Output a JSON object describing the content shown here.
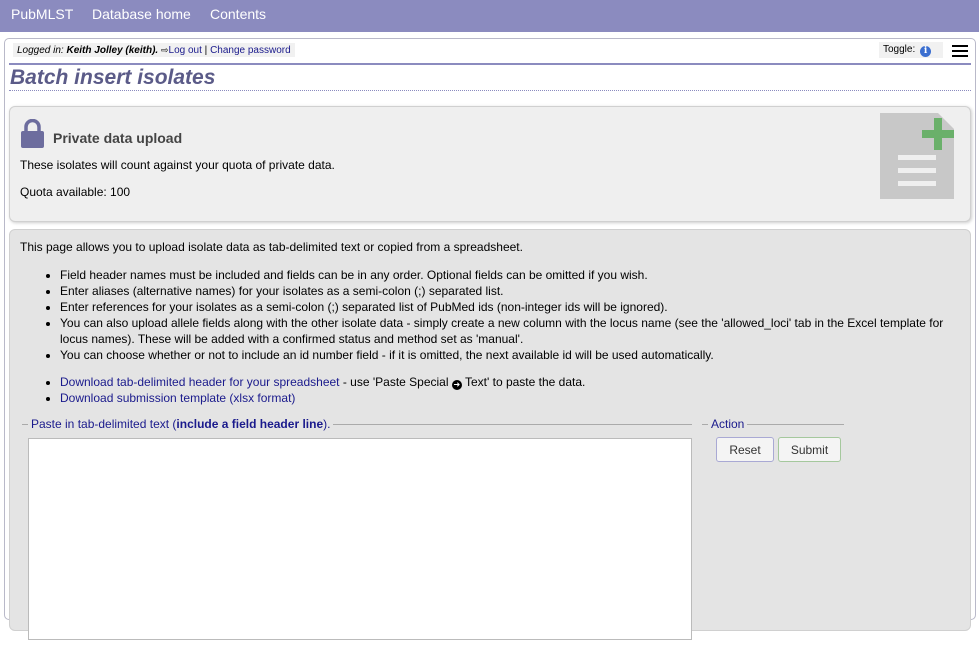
{
  "nav": {
    "items": [
      "PubMLST",
      "Database home",
      "Contents"
    ]
  },
  "userbar": {
    "logged_in_label": "Logged in:",
    "user": "Keith Jolley (keith).",
    "logout": "Log out",
    "separator": "|",
    "change_password": "Change password"
  },
  "toggle": {
    "label": "Toggle:"
  },
  "page_title": "Batch insert isolates",
  "private_box": {
    "heading": "Private data upload",
    "text": "These isolates will count against your quota of private data.",
    "quota": "Quota available: 100"
  },
  "info": {
    "intro": "This page allows you to upload isolate data as tab-delimited text or copied from a spreadsheet.",
    "bullets": [
      "Field header names must be included and fields can be in any order. Optional fields can be omitted if you wish.",
      "Enter aliases (alternative names) for your isolates as a semi-colon (;) separated list.",
      "Enter references for your isolates as a semi-colon (;) separated list of PubMed ids (non-integer ids will be ignored).",
      "You can also upload allele fields along with the other isolate data - simply create a new column with the locus name (see the 'allowed_loci' tab in the Excel template for locus names). These will be added with a confirmed status and method set as 'manual'.",
      "You can choose whether or not to include an id number field - if it is omitted, the next available id will be used automatically."
    ],
    "download_header_link": "Download tab-delimited header for your spreadsheet",
    "download_header_suffix_a": " - use 'Paste Special ",
    "download_header_suffix_b": " Text' to paste the data.",
    "download_template_link": "Download submission template (xlsx format)"
  },
  "paste": {
    "legend_a": "Paste in tab-delimited text (",
    "legend_bold": "include a field header line",
    "legend_b": ").",
    "value": ""
  },
  "action": {
    "legend": "Action",
    "reset": "Reset",
    "submit": "Submit"
  },
  "colors": {
    "brand": "#8b8bbf",
    "title": "#5b5b88",
    "link": "#1a1a8c"
  }
}
